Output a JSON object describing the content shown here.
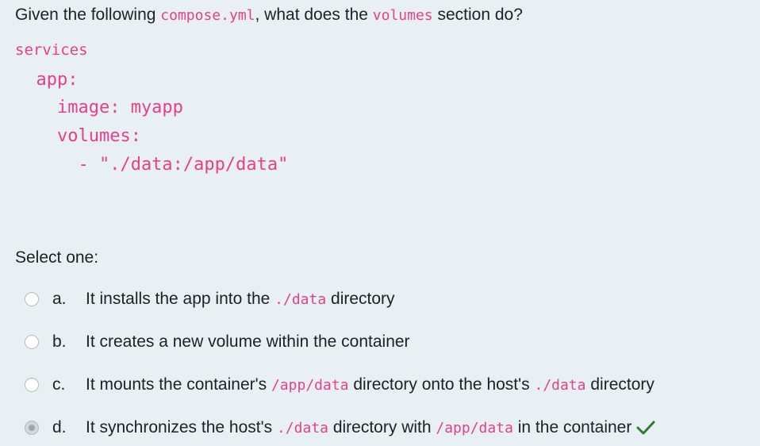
{
  "question": {
    "prefix": "Given the following ",
    "file": "compose.yml",
    "middle": ", what does the ",
    "keyword": "volumes",
    "suffix": " section do?"
  },
  "code_lines": [
    "services",
    "  app:",
    "    image: myapp",
    "    volumes:",
    "      - \"./data:/app/data\""
  ],
  "select_label": "Select one:",
  "answers": [
    {
      "letter": "a.",
      "parts": [
        {
          "text": "It installs the app into the ",
          "code": false
        },
        {
          "text": "./data",
          "code": true
        },
        {
          "text": " directory",
          "code": false
        }
      ],
      "selected": false
    },
    {
      "letter": "b.",
      "parts": [
        {
          "text": "It creates a new volume within the container",
          "code": false
        }
      ],
      "selected": false
    },
    {
      "letter": "c.",
      "parts": [
        {
          "text": "It mounts the container's ",
          "code": false
        },
        {
          "text": "/app/data",
          "code": true
        },
        {
          "text": " directory onto the host's ",
          "code": false
        },
        {
          "text": "./data",
          "code": true
        },
        {
          "text": " directory",
          "code": false
        }
      ],
      "selected": false
    },
    {
      "letter": "d.",
      "parts": [
        {
          "text": "It synchronizes the host's ",
          "code": false
        },
        {
          "text": "./data",
          "code": true
        },
        {
          "text": " directory with ",
          "code": false
        },
        {
          "text": "/app/data",
          "code": true
        },
        {
          "text": " in the container",
          "code": false
        }
      ],
      "selected": true,
      "correct_icon": "checkmark-icon"
    }
  ],
  "colors": {
    "background": "#e8f0f3",
    "code": "#e83e8c",
    "text": "#1d2125",
    "correct": "#357a32"
  }
}
